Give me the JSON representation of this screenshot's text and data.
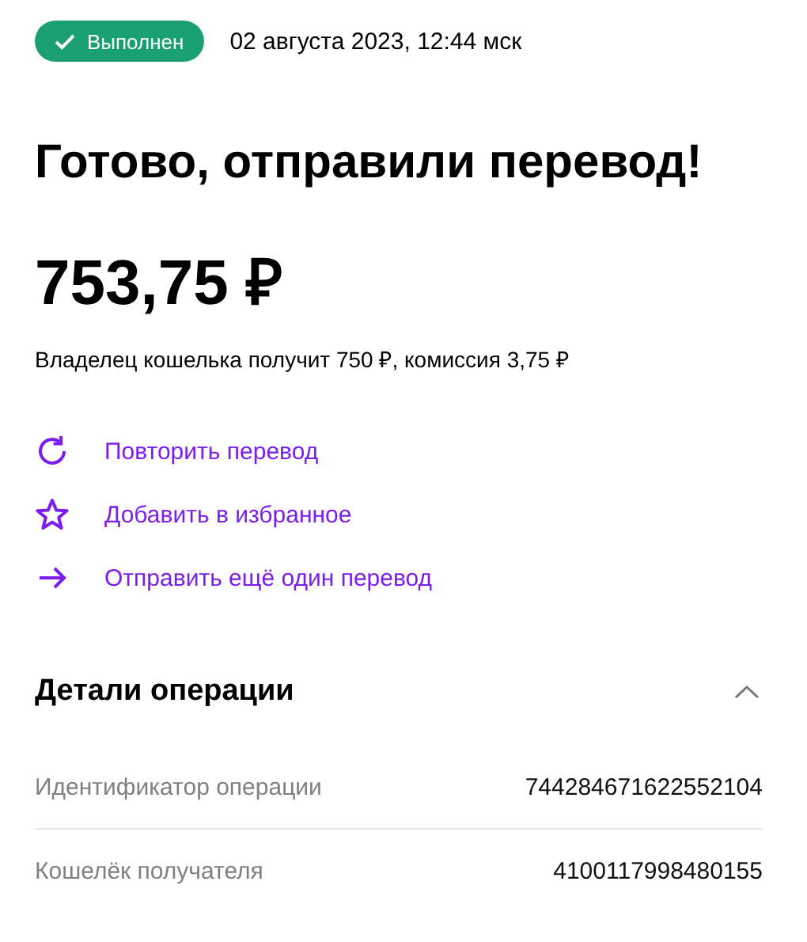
{
  "status": {
    "label": "Выполнен",
    "kind": "done"
  },
  "date": "02 августа 2023, 12:44 мск",
  "title": "Готово, отправили перевод!",
  "amount": "753,75 ₽",
  "summary": "Владелец кошелька получит 750 ₽, комиссия 3,75 ₽",
  "actions": [
    {
      "kind": "repeat",
      "label": "Повторить перевод"
    },
    {
      "kind": "favorite",
      "label": "Добавить в избранное"
    },
    {
      "kind": "send",
      "label": "Отправить ещё один перевод"
    }
  ],
  "details": {
    "title": "Детали операции",
    "expanded": true,
    "rows": [
      {
        "label": "Идентификатор операции",
        "value": "744284671622552104"
      },
      {
        "label": "Кошелёк получателя",
        "value": "4100117998480155"
      }
    ]
  }
}
